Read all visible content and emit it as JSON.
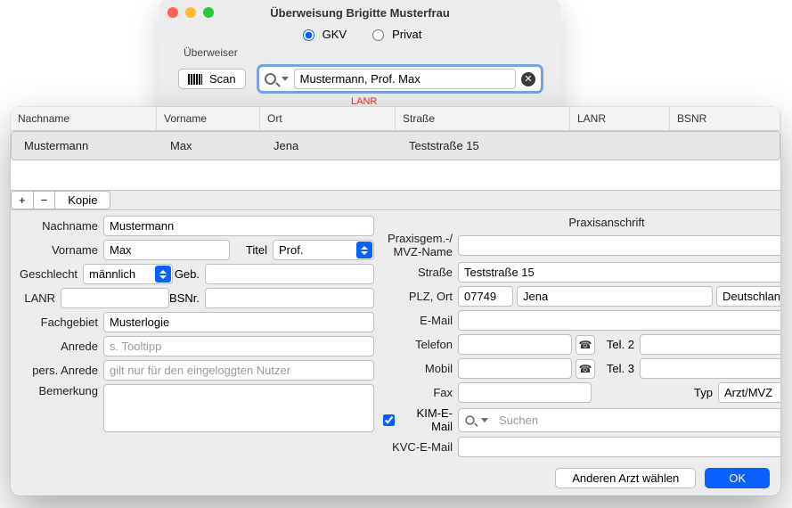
{
  "backWindow": {
    "title": "Überweisung Brigitte Musterfrau",
    "radioGkv": "GKV",
    "radioPrivat": "Privat",
    "fieldsetLabel": "Überweiser",
    "scanLabel": "Scan",
    "searchValue": "Mustermann, Prof. Max",
    "lanrHint": "LANR"
  },
  "table": {
    "headers": {
      "c1": "Nachname",
      "c2": "Vorname",
      "c3": "Ort",
      "c4": "Straße",
      "c5": "LANR",
      "c6": "BSNR"
    },
    "row": {
      "c1": "Mustermann",
      "c2": "Max",
      "c3": "Jena",
      "c4": "Teststraße 15",
      "c5": "",
      "c6": ""
    }
  },
  "toolbar": {
    "plus": "+",
    "minus": "−",
    "kopie": "Kopie"
  },
  "left": {
    "nachname_lbl": "Nachname",
    "nachname": "Mustermann",
    "vorname_lbl": "Vorname",
    "vorname": "Max",
    "titel_lbl": "Titel",
    "titel": "Prof.",
    "geschlecht_lbl": "Geschlecht",
    "geschlecht": "männlich",
    "geb_lbl": "Geb.",
    "lanr_lbl": "LANR",
    "bsnr_lbl": "BSNr.",
    "fach_lbl": "Fachgebiet",
    "fach": "Musterlogie",
    "anrede_lbl": "Anrede",
    "anrede_ph": "s. Tooltipp",
    "pers_lbl": "pers. Anrede",
    "pers_ph": "gilt nur für den eingeloggten Nutzer",
    "bem_lbl": "Bemerkung"
  },
  "right": {
    "section": "Praxisanschrift",
    "mvz_lbl": "Praxisgem.-/\nMVZ-Name",
    "str_lbl": "Straße",
    "str": "Teststraße 15",
    "plzort_lbl": "PLZ, Ort",
    "plz": "07749",
    "ort": "Jena",
    "land": "Deutschland",
    "email_lbl": "E-Mail",
    "tel_lbl": "Telefon",
    "tel2_lbl": "Tel. 2",
    "mobil_lbl": "Mobil",
    "tel3_lbl": "Tel. 3",
    "fax_lbl": "Fax",
    "typ_lbl": "Typ",
    "typ": "Arzt/MVZ",
    "kim_lbl": "KIM-E-Mail",
    "kim_ph": "Suchen",
    "kvc_lbl": "KVC-E-Mail"
  },
  "footer": {
    "other": "Anderen Arzt wählen",
    "ok": "OK"
  }
}
